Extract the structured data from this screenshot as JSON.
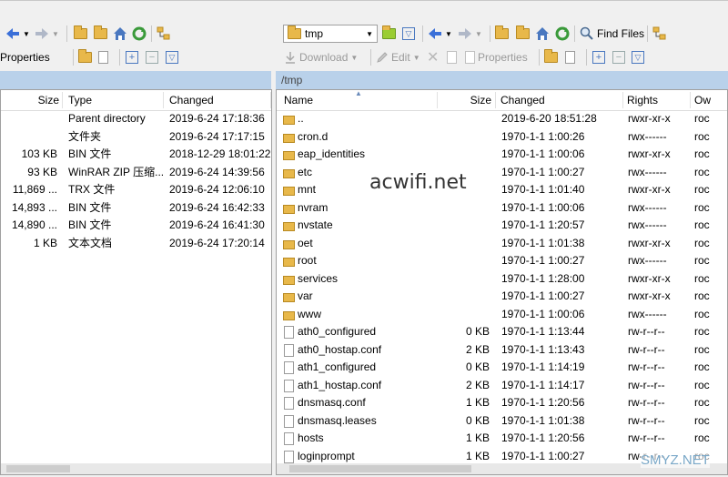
{
  "left_toolbar": {
    "properties_label": "Properties"
  },
  "right_toolbar": {
    "path_combo": "tmp",
    "find_files_label": "Find Files",
    "download_label": "Download",
    "edit_label": "Edit",
    "properties_label": "Properties"
  },
  "left_pane": {
    "columns": {
      "size": "Size",
      "type": "Type",
      "changed": "Changed"
    },
    "rows": [
      {
        "size": "",
        "type": "Parent directory",
        "changed": "2019-6-24  17:18:36"
      },
      {
        "size": "",
        "type": "文件夹",
        "changed": "2019-6-24  17:17:15"
      },
      {
        "size": "103 KB",
        "type": "BIN 文件",
        "changed": "2018-12-29  18:01:22"
      },
      {
        "size": "93 KB",
        "type": "WinRAR ZIP 压缩...",
        "changed": "2019-6-24  14:39:56"
      },
      {
        "size": "11,869 ...",
        "type": "TRX 文件",
        "changed": "2019-6-24  12:06:10"
      },
      {
        "size": "14,893 ...",
        "type": "BIN 文件",
        "changed": "2019-6-24  16:42:33"
      },
      {
        "size": "14,890 ...",
        "type": "BIN 文件",
        "changed": "2019-6-24  16:41:30"
      },
      {
        "size": "1 KB",
        "type": "文本文档",
        "changed": "2019-6-24  17:20:14"
      }
    ]
  },
  "right_pane": {
    "path": "/tmp",
    "columns": {
      "name": "Name",
      "size": "Size",
      "changed": "Changed",
      "rights": "Rights",
      "owner": "Ow"
    },
    "rows": [
      {
        "kind": "parent",
        "name": "..",
        "size": "",
        "changed": "2019-6-20 18:51:28",
        "rights": "rwxr-xr-x",
        "owner": "roc"
      },
      {
        "kind": "folder",
        "name": "cron.d",
        "size": "",
        "changed": "1970-1-1 1:00:26",
        "rights": "rwx------",
        "owner": "roc"
      },
      {
        "kind": "folder",
        "name": "eap_identities",
        "size": "",
        "changed": "1970-1-1 1:00:06",
        "rights": "rwxr-xr-x",
        "owner": "roc"
      },
      {
        "kind": "folder",
        "name": "etc",
        "size": "",
        "changed": "1970-1-1 1:00:27",
        "rights": "rwx------",
        "owner": "roc"
      },
      {
        "kind": "folder",
        "name": "mnt",
        "size": "",
        "changed": "1970-1-1 1:01:40",
        "rights": "rwxr-xr-x",
        "owner": "roc"
      },
      {
        "kind": "folder",
        "name": "nvram",
        "size": "",
        "changed": "1970-1-1 1:00:06",
        "rights": "rwx------",
        "owner": "roc"
      },
      {
        "kind": "folder",
        "name": "nvstate",
        "size": "",
        "changed": "1970-1-1 1:20:57",
        "rights": "rwx------",
        "owner": "roc"
      },
      {
        "kind": "folder",
        "name": "oet",
        "size": "",
        "changed": "1970-1-1 1:01:38",
        "rights": "rwxr-xr-x",
        "owner": "roc"
      },
      {
        "kind": "folder",
        "name": "root",
        "size": "",
        "changed": "1970-1-1 1:00:27",
        "rights": "rwx------",
        "owner": "roc"
      },
      {
        "kind": "folder",
        "name": "services",
        "size": "",
        "changed": "1970-1-1 1:28:00",
        "rights": "rwxr-xr-x",
        "owner": "roc"
      },
      {
        "kind": "folder",
        "name": "var",
        "size": "",
        "changed": "1970-1-1 1:00:27",
        "rights": "rwxr-xr-x",
        "owner": "roc"
      },
      {
        "kind": "folder",
        "name": "www",
        "size": "",
        "changed": "1970-1-1 1:00:06",
        "rights": "rwx------",
        "owner": "roc"
      },
      {
        "kind": "file",
        "name": "ath0_configured",
        "size": "0 KB",
        "changed": "1970-1-1 1:13:44",
        "rights": "rw-r--r--",
        "owner": "roc"
      },
      {
        "kind": "file",
        "name": "ath0_hostap.conf",
        "size": "2 KB",
        "changed": "1970-1-1 1:13:43",
        "rights": "rw-r--r--",
        "owner": "roc"
      },
      {
        "kind": "file",
        "name": "ath1_configured",
        "size": "0 KB",
        "changed": "1970-1-1 1:14:19",
        "rights": "rw-r--r--",
        "owner": "roc"
      },
      {
        "kind": "file",
        "name": "ath1_hostap.conf",
        "size": "2 KB",
        "changed": "1970-1-1 1:14:17",
        "rights": "rw-r--r--",
        "owner": "roc"
      },
      {
        "kind": "file",
        "name": "dnsmasq.conf",
        "size": "1 KB",
        "changed": "1970-1-1 1:20:56",
        "rights": "rw-r--r--",
        "owner": "roc"
      },
      {
        "kind": "file",
        "name": "dnsmasq.leases",
        "size": "0 KB",
        "changed": "1970-1-1 1:01:38",
        "rights": "rw-r--r--",
        "owner": "roc"
      },
      {
        "kind": "file",
        "name": "hosts",
        "size": "1 KB",
        "changed": "1970-1-1 1:20:56",
        "rights": "rw-r--r--",
        "owner": "roc"
      },
      {
        "kind": "file",
        "name": "loginprompt",
        "size": "1 KB",
        "changed": "1970-1-1 1:00:27",
        "rights": "rw-r--r--",
        "owner": "roc"
      }
    ]
  },
  "watermarks": {
    "center": "acwifi.net",
    "corner": "SMYZ.NET"
  },
  "colors": {
    "path_bar": "#b9d1ea",
    "folder": "#e8b84a",
    "nav_arrow": "#3a6fd8"
  }
}
